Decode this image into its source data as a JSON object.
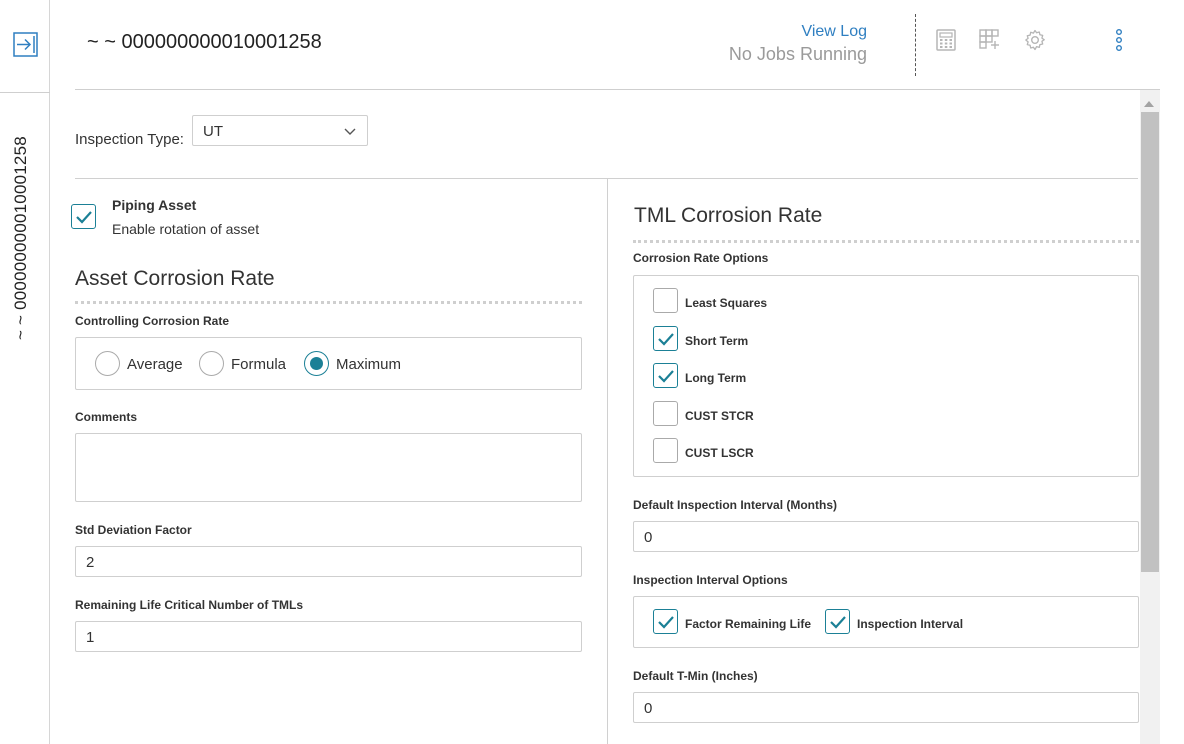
{
  "rail": {
    "expand_icon": "panel-expand-icon",
    "vertical_title": "~ ~ 000000000010001258"
  },
  "header": {
    "title": "~ ~ 000000000010001258",
    "view_log": "View Log",
    "jobs_status": "No Jobs Running",
    "icons": [
      "calculator-icon",
      "grid-add-icon",
      "gear-icon",
      "more-vertical-icon"
    ]
  },
  "inspection_type": {
    "label": "Inspection Type:",
    "selected": "UT"
  },
  "piping_asset": {
    "label": "Piping Asset",
    "description": "Enable rotation of asset",
    "checked": true
  },
  "asset_corrosion": {
    "title": "Asset Corrosion Rate",
    "controlling_label": "Controlling Corrosion Rate",
    "options": [
      {
        "label": "Average",
        "selected": false
      },
      {
        "label": "Formula",
        "selected": false
      },
      {
        "label": "Maximum",
        "selected": true
      }
    ],
    "comments_label": "Comments",
    "comments_value": "",
    "std_dev_label": "Std Deviation Factor",
    "std_dev_value": "2",
    "remaining_life_label": "Remaining Life Critical Number of TMLs",
    "remaining_life_value": "1"
  },
  "tml_corrosion": {
    "title": "TML Corrosion Rate",
    "options_label": "Corrosion Rate Options",
    "options": [
      {
        "label": "Least Squares",
        "checked": false
      },
      {
        "label": "Short Term",
        "checked": true
      },
      {
        "label": "Long Term",
        "checked": true
      },
      {
        "label": "CUST STCR",
        "checked": false
      },
      {
        "label": "CUST LSCR",
        "checked": false
      }
    ],
    "default_interval_label": "Default Inspection Interval (Months)",
    "default_interval_value": "0",
    "interval_options_label": "Inspection Interval Options",
    "interval_options": [
      {
        "label": "Factor Remaining Life",
        "checked": true
      },
      {
        "label": "Inspection Interval",
        "checked": true
      }
    ],
    "default_tmin_label": "Default T-Min (Inches)",
    "default_tmin_value": "0"
  },
  "colors": {
    "accent": "#1b8096",
    "link": "#2f7fc1",
    "muted": "#9a9a9a",
    "border": "#cfcfcf"
  }
}
